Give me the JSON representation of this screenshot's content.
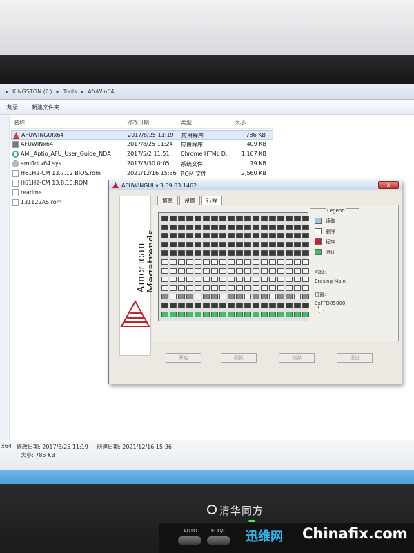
{
  "explorer": {
    "breadcrumb": [
      "KINGSTON (F:)",
      "Tools",
      "AfuWin64"
    ],
    "toolbar": [
      "刻录",
      "新建文件夹"
    ],
    "columns": {
      "name": "名称",
      "date": "修改日期",
      "type": "类型",
      "size": "大小"
    },
    "files": [
      {
        "name": "AFUWINGUIx64",
        "date": "2017/8/25 11:19",
        "type": "应用程序",
        "size": "786 KB",
        "icon": "afu-app-icon"
      },
      {
        "name": "AFUWINx64",
        "date": "2017/8/25 11:24",
        "type": "应用程序",
        "size": "409 KB",
        "icon": "app-icon"
      },
      {
        "name": "AMI_Aptio_AFU_User_Guide_NDA",
        "date": "2017/5/2 11:51",
        "type": "Chrome HTML D...",
        "size": "1,167 KB",
        "icon": "chrome-document-icon"
      },
      {
        "name": "amifldrv64.sys",
        "date": "2017/3/30 0:05",
        "type": "系统文件",
        "size": "19 KB",
        "icon": "gear-file-icon"
      },
      {
        "name": "H61H2-CM  13.7.12 BIOS.rom",
        "date": "2021/12/16 15:36",
        "type": "ROM 文件",
        "size": "2,560 KB",
        "icon": "file-icon"
      },
      {
        "name": "H61H2-CM  13.8.15.ROM",
        "date": "",
        "type": "",
        "size": "",
        "icon": "file-icon"
      },
      {
        "name": "readme",
        "date": "",
        "type": "",
        "size": "",
        "icon": "file-icon"
      },
      {
        "name": "131122AS.rom",
        "date": "",
        "type": "",
        "size": "",
        "icon": "file-icon"
      }
    ],
    "status": {
      "name_fragment": "x64",
      "modified": "修改日期: 2017/8/25 11:19",
      "created": "创建日期: 2021/12/16 15:36",
      "size": "大小: 785 KB"
    }
  },
  "dialog": {
    "title": "AFUWINGUI v.3.09.03.1462",
    "close_label": "x",
    "brand_line1": "American",
    "brand_line2": "Megatrends",
    "tabs": [
      "信息",
      "设置",
      "行程"
    ],
    "legend": {
      "title": "Legend",
      "items": [
        {
          "label": "读取",
          "color": "#9fc6dc"
        },
        {
          "label": "删除",
          "color": "#ffffff"
        },
        {
          "label": "程序",
          "color": "#d0202a"
        },
        {
          "label": "验证",
          "color": "#3fbf6a"
        }
      ]
    },
    "info": {
      "stage_label": "阶段:",
      "stage_value": "Erasing Main",
      "addr_label": "位置:",
      "addr_value": "0xFFD85000"
    },
    "buttons": [
      "开启",
      "刷新",
      "储存",
      "退出"
    ]
  },
  "monitor": {
    "brand": "清华同方",
    "auto_label": "AUTO",
    "eco_label": "ECO/-"
  },
  "watermark": {
    "cn": "迅维网",
    "en": "Chinafix.com"
  }
}
